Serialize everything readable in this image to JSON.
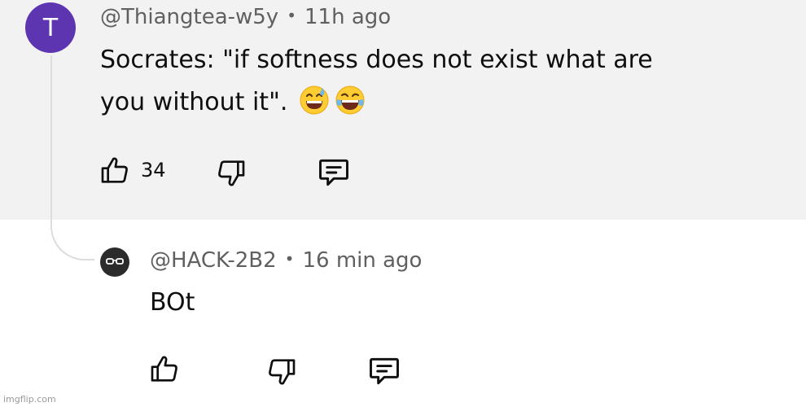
{
  "parent_comment": {
    "avatar_letter": "T",
    "avatar_color": "#5e35b1",
    "author": "@Thiangtea-w5y",
    "separator": "•",
    "time": "11h ago",
    "text_line1": "Socrates: \"if softness does not exist what are",
    "text_line2": "you without it\".",
    "emojis": [
      "grinning-face-with-sweat-emoji",
      "face-with-tears-of-joy-emoji"
    ],
    "like_count": "34",
    "icons": [
      "thumbs-up-icon",
      "thumbs-down-icon",
      "reply-comment-icon"
    ]
  },
  "reply_comment": {
    "avatar_icon": "glasses-avatar-icon",
    "author": "@HACK-2B2",
    "separator": "•",
    "time": "16 min ago",
    "text": "BOt",
    "icons": [
      "thumbs-up-icon",
      "thumbs-down-icon",
      "reply-comment-icon"
    ]
  },
  "watermark": "imgflip.com",
  "colors": {
    "parent_background": "#f2f2f2",
    "meta_text": "#606060",
    "thread_line": "#dddddd"
  }
}
